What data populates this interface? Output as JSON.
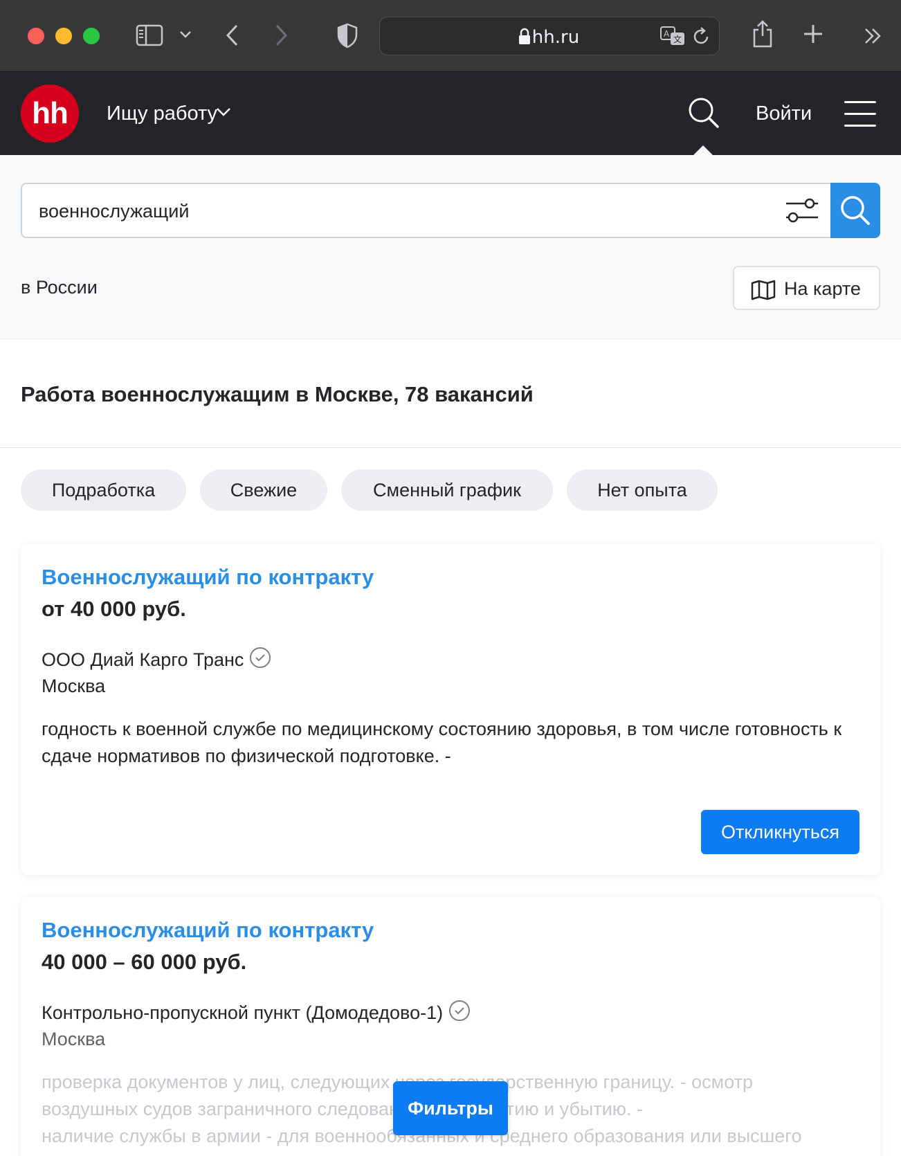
{
  "browser": {
    "url": "hh.ru",
    "icons": [
      "sidebar-icon",
      "chevron-down-icon",
      "back-icon",
      "forward-icon",
      "shield-icon",
      "lock-icon",
      "translate-icon",
      "reload-icon",
      "share-icon",
      "new-tab-icon",
      "more-icon"
    ]
  },
  "header": {
    "logo": "hh",
    "mode_label": "Ищу работу",
    "login_label": "Войти"
  },
  "search": {
    "query": "военнослужащий",
    "region": "в России",
    "map_label": "На карте"
  },
  "results": {
    "title": "Работа военнослужащим в Москве, 78 вакансий"
  },
  "chips": [
    "Подработка",
    "Свежие",
    "Сменный график",
    "Нет опыта"
  ],
  "vacancies": [
    {
      "title": "Военнослужащий по контракту",
      "salary": "от 40 000 руб.",
      "company": "ООО Диай Карго Транс",
      "city": "Москва",
      "snippet": "годность к военной службе по медицинскому состоянию здоровья, в том числе готовность к сдаче нормативов по физической подготовке. -",
      "apply_label": "Откликнуться"
    },
    {
      "title": "Военнослужащий по контракту",
      "salary": "40 000 – 60 000 руб.",
      "company": "Контрольно-пропускной пункт (Домодедово-1)",
      "city": "Москва",
      "snippet_lines": [
        "проверка документов у лиц, следующих через государственную границу. - осмотр",
        "воздушных судов заграничного следования по прибытию и убытию. -",
        "наличие службы в армии - для военнообязанных и среднего образования или высшего"
      ]
    }
  ],
  "filters_button": "Фильтры",
  "colors": {
    "brand_red": "#d6001c",
    "link_blue": "#2a8de6",
    "button_blue": "#0d7cf2",
    "header_bg": "#232529"
  }
}
